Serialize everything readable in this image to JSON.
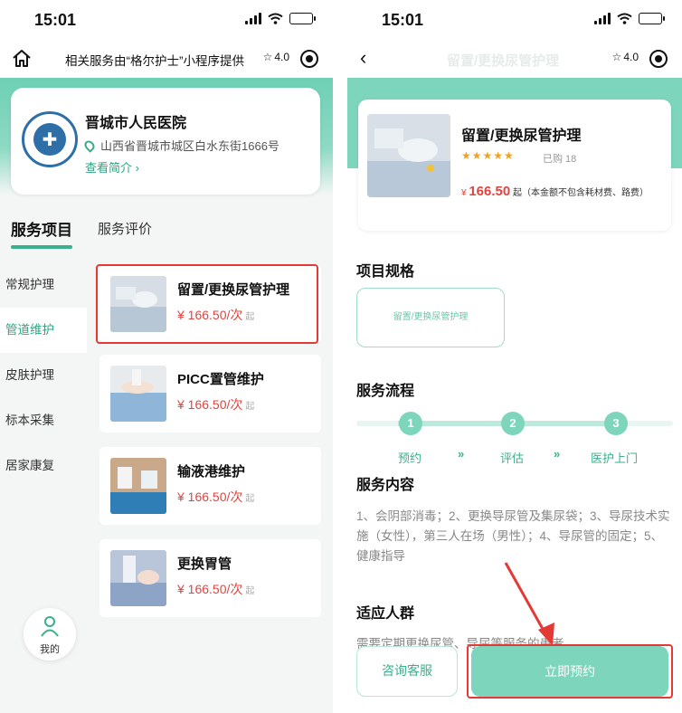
{
  "status_bar": {
    "time": "15:01"
  },
  "left": {
    "nav": {
      "title": "相关服务由“格尔护士”小程序提供",
      "rating": "4.0"
    },
    "hospital": {
      "name": "晋城市人民医院",
      "address": "山西省晋城市城区白水东街1666号",
      "intro_link": "查看简介 ›"
    },
    "tabs": {
      "active": "服务项目",
      "other": "服务评价"
    },
    "categories": [
      "常规护理",
      "管道维护",
      "皮肤护理",
      "标本采集",
      "居家康复"
    ],
    "services": [
      {
        "name": "留置/更换尿管护理",
        "price": "¥ 166.50/次",
        "suffix": "起"
      },
      {
        "name": "PICC置管维护",
        "price": "¥ 166.50/次",
        "suffix": "起"
      },
      {
        "name": "输液港维护",
        "price": "¥ 166.50/次",
        "suffix": "起"
      },
      {
        "name": "更换胃管",
        "price": "¥ 166.50/次",
        "suffix": "起"
      }
    ],
    "me_label": "我的"
  },
  "right": {
    "nav": {
      "title": "留置/更换尿管护理",
      "rating": "4.0"
    },
    "product": {
      "name": "留置/更换尿管护理",
      "stars": "★★★★★",
      "sold": "已购 18",
      "price_symbol": "¥",
      "price": "166.50",
      "price_suffix": "起",
      "price_note": "（本金额不包含耗材费、路费）"
    },
    "spec": {
      "title": "项目规格",
      "option": "留置/更换尿管护理"
    },
    "flow": {
      "title": "服务流程",
      "steps": [
        {
          "num": "1",
          "label": "预约"
        },
        {
          "num": "2",
          "label": "评估"
        },
        {
          "num": "3",
          "label": "医护上门"
        }
      ],
      "arrow": "»"
    },
    "content": {
      "title": "服务内容",
      "text": "1、会阴部消毒；2、更换导尿管及集尿袋；3、导尿技术实施（女性），第三人在场（男性）；4、导尿管的固定；5、健康指导"
    },
    "audience": {
      "title": "适应人群",
      "text": "需要定期更换尿管、导尿等服务的患者"
    },
    "buttons": {
      "consult": "咨询客服",
      "book": "立即预约"
    }
  },
  "colors": {
    "accent": "#7dd6bc",
    "accent_dark": "#3ab08c",
    "price": "#e0443f",
    "highlight": "#e53935"
  }
}
